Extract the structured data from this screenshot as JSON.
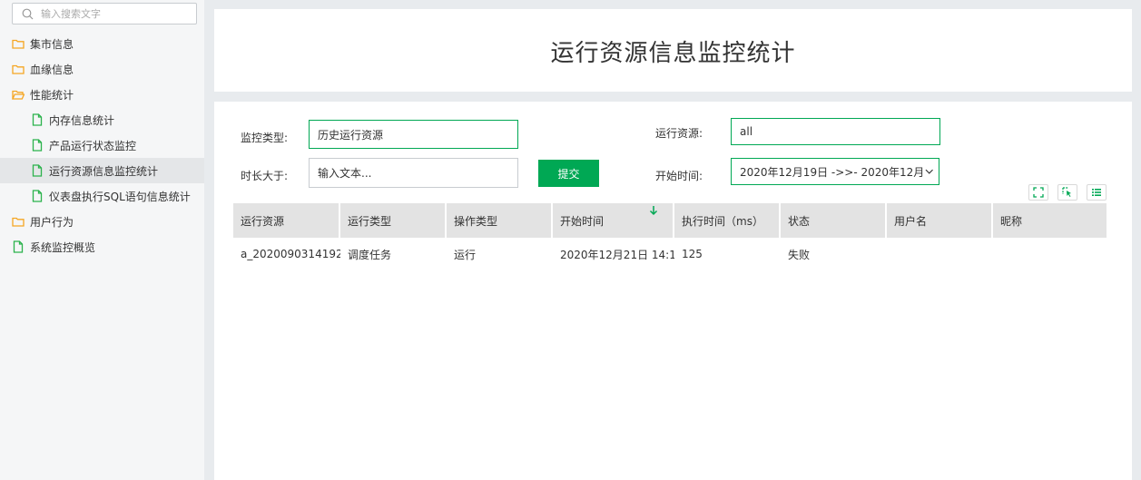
{
  "sidebar": {
    "search_placeholder": "输入搜索文字",
    "items": [
      {
        "label": "集市信息"
      },
      {
        "label": "血缘信息"
      },
      {
        "label": "性能统计"
      },
      {
        "label": "内存信息统计"
      },
      {
        "label": "产品运行状态监控"
      },
      {
        "label": "运行资源信息监控统计"
      },
      {
        "label": "仪表盘执行SQL语句信息统计"
      },
      {
        "label": "用户行为"
      },
      {
        "label": "系统监控概览"
      }
    ]
  },
  "header": {
    "title": "运行资源信息监控统计"
  },
  "form": {
    "monitor_type_label": "监控类型:",
    "monitor_type_value": "历史运行资源",
    "duration_label": "时长大于:",
    "duration_placeholder": "输入文本...",
    "submit_label": "提交",
    "resource_label": "运行资源:",
    "resource_value": "all",
    "start_time_label": "开始时间:",
    "start_time_value": "2020年12月19日 ->>- 2020年12月..."
  },
  "table": {
    "columns": [
      "运行资源",
      "运行类型",
      "操作类型",
      "开始时间",
      "执行时间（ms）",
      "状态",
      "用户名",
      "昵称"
    ],
    "rows": [
      [
        "a_2020090314192",
        "调度任务",
        "运行",
        "2020年12月21日 14:1",
        "125",
        "失败",
        "",
        ""
      ]
    ]
  },
  "colors": {
    "accent": "#00a854",
    "folder": "#f5a623",
    "file": "#2bb24c"
  }
}
